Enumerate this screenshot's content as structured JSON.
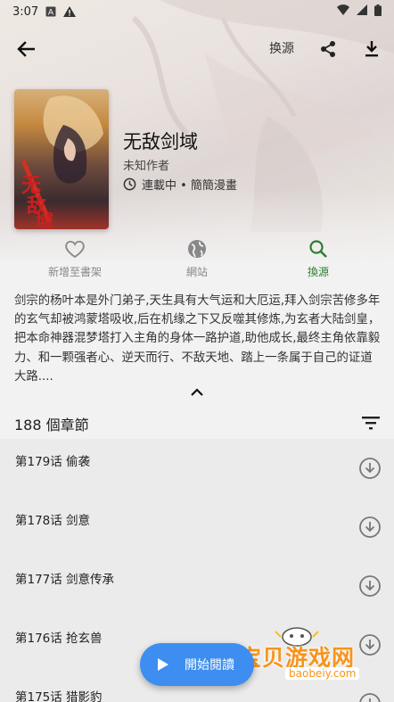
{
  "status_bar": {
    "time": "3:07"
  },
  "toolbar": {
    "swap_source": "换源"
  },
  "book": {
    "title": "无敌剑域",
    "author": "未知作者",
    "status": "連載中 • 簡簡漫畫"
  },
  "actions": [
    {
      "label": "新增至書架",
      "icon": "heart-outline-icon",
      "active": false
    },
    {
      "label": "網站",
      "icon": "globe-icon",
      "active": false
    },
    {
      "label": "換源",
      "icon": "search-icon",
      "active": true
    }
  ],
  "description": "剑宗的杨叶本是外门弟子,天生具有大气运和大厄运,拜入剑宗苦修多年的玄气却被鸿蒙塔吸收,后在机缘之下又反噬其修炼,为玄者大陆剑皇，把本命神器混梦塔打入主角的身体一路护道,助他成长,最终主角依靠毅力、和一颗强者心、逆天而行、不敌天地、踏上一条属于自己的证道大路....",
  "chapters": {
    "count_label": "188 個章節",
    "items": [
      {
        "name": "第179话 偷袭"
      },
      {
        "name": "第178话 剑意"
      },
      {
        "name": "第177话 剑意传承"
      },
      {
        "name": "第176话 抢玄兽"
      },
      {
        "name": "第175话 猎影豹"
      }
    ]
  },
  "fab": {
    "label": "開始閱讀"
  },
  "watermark": {
    "text": "宝贝游戏网",
    "url": "baobeiy.com"
  },
  "colors": {
    "accent_green": "#2e7d32",
    "fab_blue": "#3d8ef0",
    "watermark_orange": "#f7941d"
  }
}
